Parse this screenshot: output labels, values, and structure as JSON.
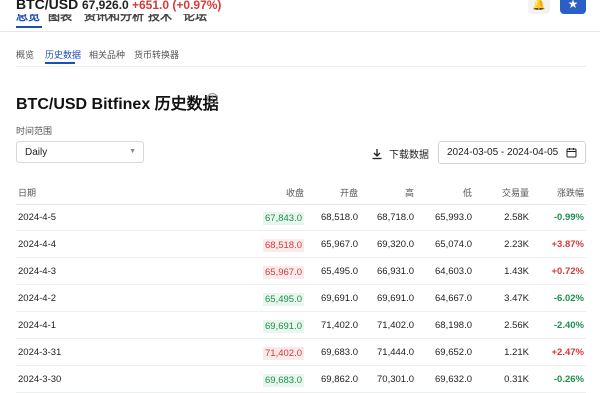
{
  "header": {
    "pair": "BTC/USD",
    "price": "67,926.0",
    "change": "+651.0",
    "change_pct": "(+0.97%)",
    "tabs": [
      "总览",
      "图表",
      "资讯和分析",
      "技术",
      "论坛"
    ]
  },
  "subtabs": [
    "概览",
    "历史数据",
    "相关品种",
    "货币转换器"
  ],
  "title": "BTC/USD Bitfinex 历史数据",
  "range_label": "时间范围",
  "period": "Daily",
  "download_label": "下载数据",
  "date_range": "2024-03-05 - 2024-04-05",
  "table": {
    "headers": [
      "日期",
      "收盘",
      "开盘",
      "高",
      "低",
      "交易量",
      "涨跌幅"
    ],
    "rows": [
      {
        "date": "2024-4-5",
        "close": "67,843.0",
        "close_dir": "up",
        "open": "68,518.0",
        "high": "68,718.0",
        "low": "65,993.0",
        "vol": "2.58K",
        "chg": "-0.99%"
      },
      {
        "date": "2024-4-4",
        "close": "68,518.0",
        "close_dir": "down",
        "open": "65,967.0",
        "high": "69,320.0",
        "low": "65,074.0",
        "vol": "2.23K",
        "chg": "+3.87%"
      },
      {
        "date": "2024-4-3",
        "close": "65,967.0",
        "close_dir": "down",
        "open": "65,495.0",
        "high": "66,931.0",
        "low": "64,603.0",
        "vol": "1.43K",
        "chg": "+0.72%"
      },
      {
        "date": "2024-4-2",
        "close": "65,495.0",
        "close_dir": "up",
        "open": "69,691.0",
        "high": "69,691.0",
        "low": "64,667.0",
        "vol": "3.47K",
        "chg": "-6.02%"
      },
      {
        "date": "2024-4-1",
        "close": "69,691.0",
        "close_dir": "up",
        "open": "71,402.0",
        "high": "71,402.0",
        "low": "68,198.0",
        "vol": "2.56K",
        "chg": "-2.40%"
      },
      {
        "date": "2024-3-31",
        "close": "71,402.0",
        "close_dir": "down",
        "open": "69,683.0",
        "high": "71,444.0",
        "low": "69,652.0",
        "vol": "1.21K",
        "chg": "+2.47%"
      },
      {
        "date": "2024-3-30",
        "close": "69,683.0",
        "close_dir": "up",
        "open": "69,862.0",
        "high": "70,301.0",
        "low": "69,632.0",
        "vol": "0.31K",
        "chg": "-0.26%"
      }
    ]
  },
  "colors": {
    "accent": "#1b4fb8",
    "up": "#1e8f4e",
    "down": "#d23b3b",
    "star_button": "#2b5fc5"
  },
  "icons": {
    "alert": "bell-plus-icon",
    "watchlist": "star-icon",
    "info": "info-icon",
    "download": "download-icon",
    "calendar": "calendar-icon",
    "dropdown": "chevron-down-icon"
  }
}
